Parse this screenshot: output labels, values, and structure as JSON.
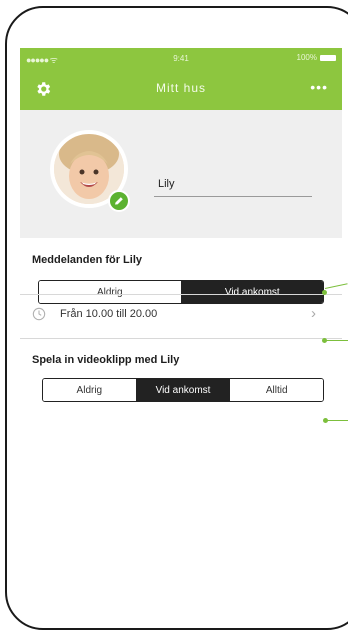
{
  "status_bar": {
    "carrier": "●●●●● ᯤ",
    "time": "9:41",
    "battery": "100%"
  },
  "nav": {
    "title": "Mitt hus",
    "settings_icon": "gear-icon",
    "more_label": "•••"
  },
  "profile": {
    "name": "Lily",
    "edit_icon": "pencil-icon"
  },
  "notifications": {
    "title": "Meddelanden för Lily",
    "options": [
      "Aldrig",
      "Vid ankomst"
    ],
    "selected": "Vid ankomst"
  },
  "schedule": {
    "label": "Från 10.00 till 20.00",
    "icon": "clock-icon",
    "chevron": "›"
  },
  "video": {
    "title": "Spela in videoklipp med Lily",
    "options": [
      "Aldrig",
      "Vid ankomst",
      "Alltid"
    ],
    "selected": "Vid ankomst"
  },
  "colors": {
    "accent": "#8dc63f",
    "segment_active": "#222222",
    "profile_bg": "#efefef"
  }
}
